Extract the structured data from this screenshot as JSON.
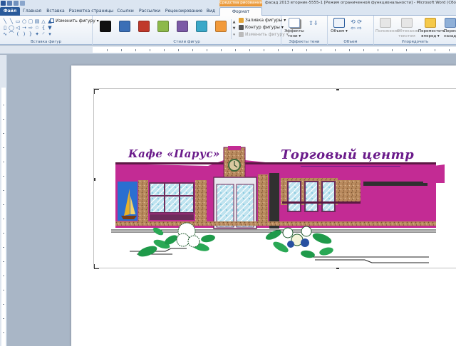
{
  "title_bar": {
    "context_tab": "Средства рисования",
    "doc_title": "фасад 2013 вторник-5555-1 [Режим ограниченной функциональности] - Microsoft Word (Сбой актив"
  },
  "tabs": [
    {
      "label": "Файл"
    },
    {
      "label": "Главная"
    },
    {
      "label": "Вставка"
    },
    {
      "label": "Разметка страницы"
    },
    {
      "label": "Ссылки"
    },
    {
      "label": "Рассылки"
    },
    {
      "label": "Рецензирование"
    },
    {
      "label": "Вид"
    },
    {
      "label": "Формат"
    }
  ],
  "ribbon": {
    "insert_shapes": {
      "label": "Вставка фигур",
      "edit_shape": "Изменить фигуру"
    },
    "shape_styles": {
      "label": "Стили фигур",
      "swatches": [
        "#111111",
        "#3b6fb6",
        "#c0392b",
        "#8db94a",
        "#7b5aa6",
        "#3aa8c8",
        "#f29a3a"
      ],
      "fill": "Заливка фигуры",
      "outline": "Контур фигуры",
      "change": "Изменить фигуру"
    },
    "shadow_effects": {
      "label": "Эффекты тени",
      "button": "Эффекты тени"
    },
    "volume": {
      "label": "Объем",
      "button": "Объем"
    },
    "arrange": {
      "label": "Упорядочить",
      "position": "Положение",
      "wrap": "Обтекание текстом",
      "bring_forward": "Переместить вперед",
      "send_back": "Перемест назад"
    }
  },
  "drawing": {
    "cafe_sign": "Кафе «Парус»",
    "mall_sign": "Торговый центр"
  }
}
